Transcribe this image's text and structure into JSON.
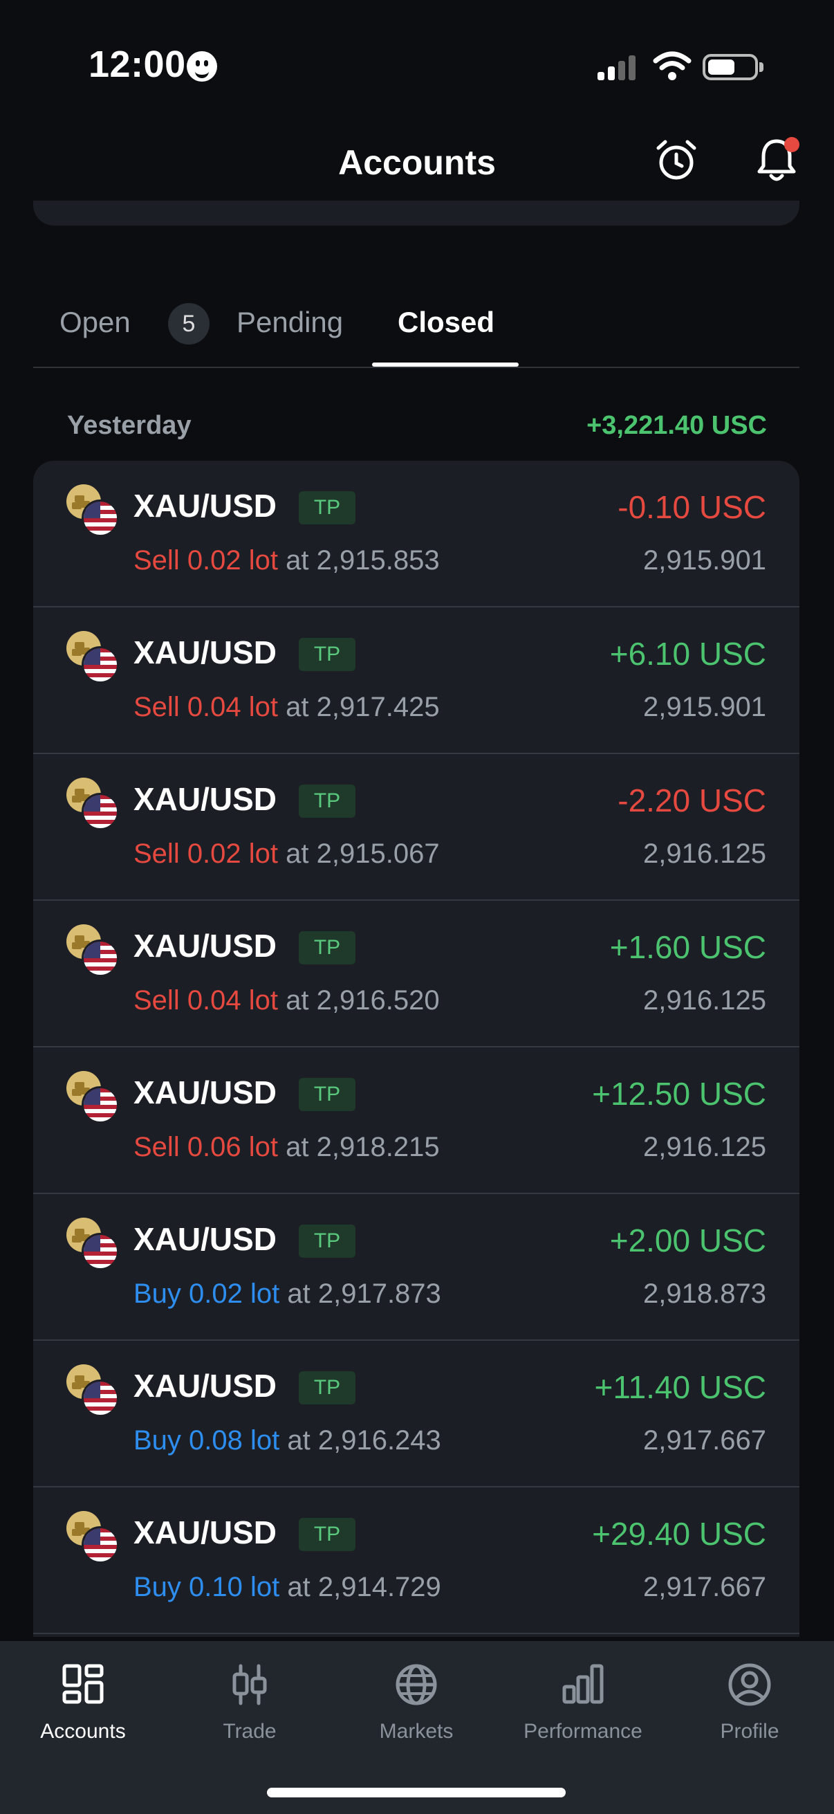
{
  "status_bar": {
    "time": "12:00"
  },
  "header": {
    "title": "Accounts"
  },
  "tabs": [
    {
      "label": "Open",
      "badge": "5"
    },
    {
      "label": "Pending"
    },
    {
      "label": "Closed"
    }
  ],
  "active_tab": "Closed",
  "group": {
    "label": "Yesterday",
    "total": "+3,221.40 USC"
  },
  "trades": [
    {
      "symbol": "XAU/USD",
      "tag": "TP",
      "pnl": "-0.10 USC",
      "side": "Sell 0.02 lot",
      "open": "at 2,915.853",
      "close": "2,915.901"
    },
    {
      "symbol": "XAU/USD",
      "tag": "TP",
      "pnl": "+6.10 USC",
      "side": "Sell 0.04 lot",
      "open": "at 2,917.425",
      "close": "2,915.901"
    },
    {
      "symbol": "XAU/USD",
      "tag": "TP",
      "pnl": "-2.20 USC",
      "side": "Sell 0.02 lot",
      "open": "at 2,915.067",
      "close": "2,916.125"
    },
    {
      "symbol": "XAU/USD",
      "tag": "TP",
      "pnl": "+1.60 USC",
      "side": "Sell 0.04 lot",
      "open": "at 2,916.520",
      "close": "2,916.125"
    },
    {
      "symbol": "XAU/USD",
      "tag": "TP",
      "pnl": "+12.50 USC",
      "side": "Sell 0.06 lot",
      "open": "at 2,918.215",
      "close": "2,916.125"
    },
    {
      "symbol": "XAU/USD",
      "tag": "TP",
      "pnl": "+2.00 USC",
      "side": "Buy 0.02 lot",
      "open": "at 2,917.873",
      "close": "2,918.873"
    },
    {
      "symbol": "XAU/USD",
      "tag": "TP",
      "pnl": "+11.40 USC",
      "side": "Buy 0.08 lot",
      "open": "at 2,916.243",
      "close": "2,917.667"
    },
    {
      "symbol": "XAU/USD",
      "tag": "TP",
      "pnl": "+29.40 USC",
      "side": "Buy 0.10 lot",
      "open": "at 2,914.729",
      "close": "2,917.667"
    }
  ],
  "bottom_nav": [
    {
      "label": "Accounts",
      "icon": "grid-icon"
    },
    {
      "label": "Trade",
      "icon": "candles-icon"
    },
    {
      "label": "Markets",
      "icon": "globe-icon"
    },
    {
      "label": "Performance",
      "icon": "bar-chart-icon"
    },
    {
      "label": "Profile",
      "icon": "user-circle-icon"
    }
  ],
  "active_nav": "Accounts",
  "colors": {
    "background": "#0b0d10",
    "card": "#1b1f25",
    "profit": "#4cc46f",
    "loss": "#e5493f",
    "buy": "#2e8ef0",
    "muted": "#9aa0a8"
  }
}
